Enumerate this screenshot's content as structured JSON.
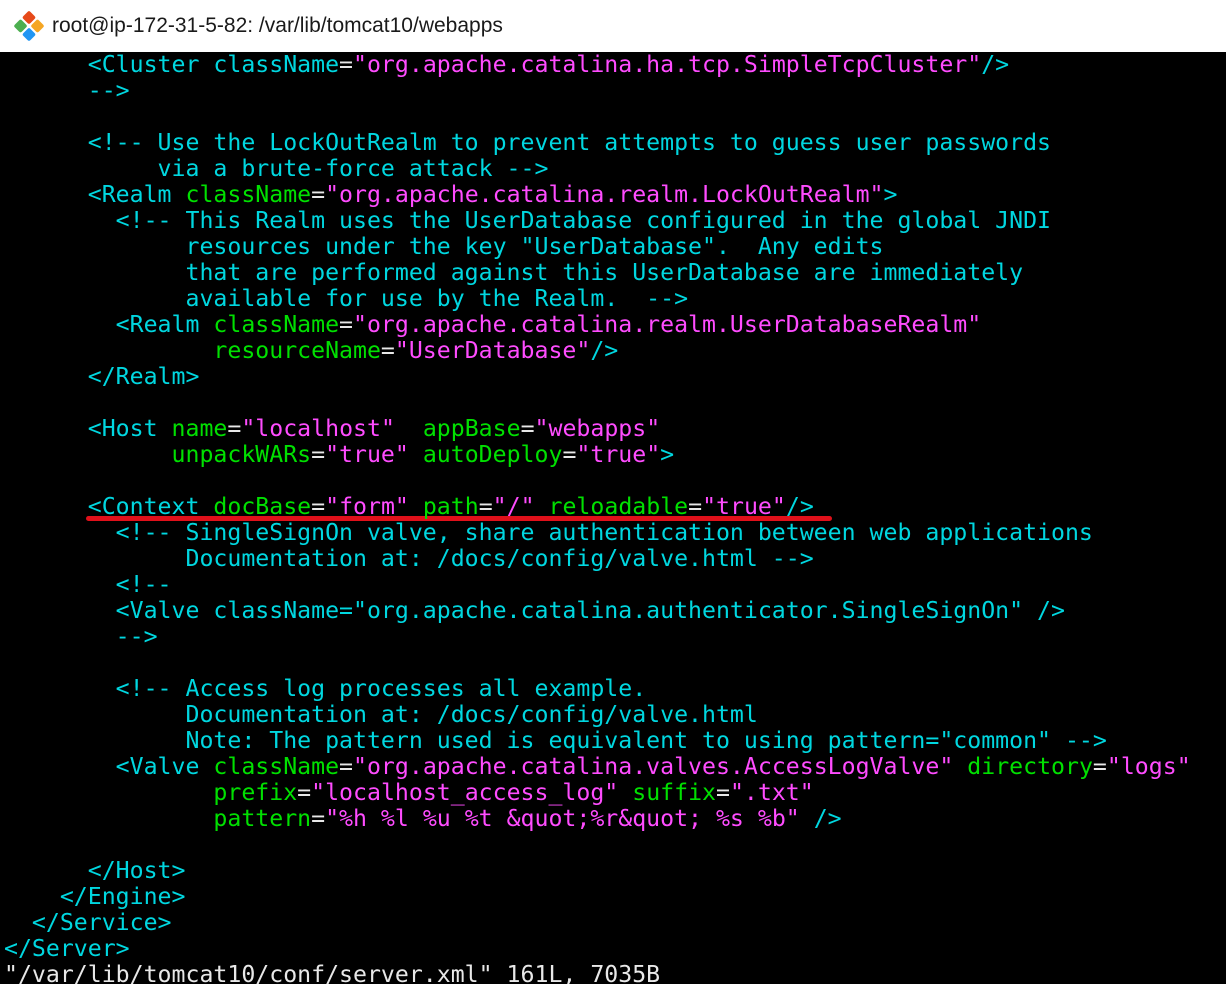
{
  "window": {
    "title": "root@ip-172-31-5-82: /var/lib/tomcat10/webapps",
    "icon": "git-bash-diamond-icon"
  },
  "colors": {
    "background": "#000000",
    "tag": "#00d7e0",
    "attribute": "#00e000",
    "string": "#ff4cff",
    "comment": "#00d7e0",
    "highlight_underline": "#e0101a"
  },
  "lines": [
    [
      [
        "t",
        "      <Cluster "
      ],
      [
        "t",
        "className"
      ],
      [
        "p",
        "="
      ],
      [
        "s",
        "\"org.apache.catalina.ha.tcp.SimpleTcpCluster\""
      ],
      [
        "t",
        "/>"
      ]
    ],
    [
      [
        "c",
        "      -->"
      ]
    ],
    [],
    [
      [
        "c",
        "      <!-- Use the LockOutRealm to prevent attempts to guess user passwords"
      ]
    ],
    [
      [
        "c",
        "           via a brute-force attack -->"
      ]
    ],
    [
      [
        "t",
        "      <Realm "
      ],
      [
        "a",
        "className"
      ],
      [
        "p",
        "="
      ],
      [
        "s",
        "\"org.apache.catalina.realm.LockOutRealm\""
      ],
      [
        "t",
        ">"
      ]
    ],
    [
      [
        "c",
        "        <!-- This Realm uses the UserDatabase configured in the global JNDI"
      ]
    ],
    [
      [
        "c",
        "             resources under the key \"UserDatabase\".  Any edits"
      ]
    ],
    [
      [
        "c",
        "             that are performed against this UserDatabase are immediately"
      ]
    ],
    [
      [
        "c",
        "             available for use by the Realm.  -->"
      ]
    ],
    [
      [
        "t",
        "        <Realm "
      ],
      [
        "a",
        "className"
      ],
      [
        "p",
        "="
      ],
      [
        "s",
        "\"org.apache.catalina.realm.UserDatabaseRealm\""
      ]
    ],
    [
      [
        "a",
        "               resourceName"
      ],
      [
        "p",
        "="
      ],
      [
        "s",
        "\"UserDatabase\""
      ],
      [
        "t",
        "/>"
      ]
    ],
    [
      [
        "t",
        "      </Realm>"
      ]
    ],
    [],
    [
      [
        "t",
        "      <Host "
      ],
      [
        "a",
        "name"
      ],
      [
        "p",
        "="
      ],
      [
        "s",
        "\"localhost\""
      ],
      [
        "t",
        "  "
      ],
      [
        "a",
        "appBase"
      ],
      [
        "p",
        "="
      ],
      [
        "s",
        "\"webapps\""
      ]
    ],
    [
      [
        "a",
        "            unpackWARs"
      ],
      [
        "p",
        "="
      ],
      [
        "s",
        "\"true\""
      ],
      [
        "t",
        " "
      ],
      [
        "a",
        "autoDeploy"
      ],
      [
        "p",
        "="
      ],
      [
        "s",
        "\"true\""
      ],
      [
        "t",
        ">"
      ]
    ],
    [],
    [
      [
        "t",
        "      <Context "
      ],
      [
        "a",
        "docBase"
      ],
      [
        "p",
        "="
      ],
      [
        "s",
        "\"form\""
      ],
      [
        "t",
        " "
      ],
      [
        "a",
        "path"
      ],
      [
        "p",
        "="
      ],
      [
        "s",
        "\"/\""
      ],
      [
        "t",
        " "
      ],
      [
        "a",
        "reloadable"
      ],
      [
        "p",
        "="
      ],
      [
        "s",
        "\"true\""
      ],
      [
        "t",
        "/>"
      ]
    ],
    [
      [
        "c",
        "        <!-- SingleSignOn valve, share authentication between web applications"
      ]
    ],
    [
      [
        "c",
        "             Documentation at: /docs/config/valve.html -->"
      ]
    ],
    [
      [
        "c",
        "        <!--"
      ]
    ],
    [
      [
        "c",
        "        <Valve className=\"org.apache.catalina.authenticator.SingleSignOn\" />"
      ]
    ],
    [
      [
        "c",
        "        -->"
      ]
    ],
    [],
    [
      [
        "c",
        "        <!-- Access log processes all example."
      ]
    ],
    [
      [
        "c",
        "             Documentation at: /docs/config/valve.html"
      ]
    ],
    [
      [
        "c",
        "             Note: The pattern used is equivalent to using pattern=\"common\" -->"
      ]
    ],
    [
      [
        "t",
        "        <Valve "
      ],
      [
        "a",
        "className"
      ],
      [
        "p",
        "="
      ],
      [
        "s",
        "\"org.apache.catalina.valves.AccessLogValve\""
      ],
      [
        "t",
        " "
      ],
      [
        "a",
        "directory"
      ],
      [
        "p",
        "="
      ],
      [
        "s",
        "\"logs\""
      ]
    ],
    [
      [
        "a",
        "               prefix"
      ],
      [
        "p",
        "="
      ],
      [
        "s",
        "\"localhost_access_log\""
      ],
      [
        "t",
        " "
      ],
      [
        "a",
        "suffix"
      ],
      [
        "p",
        "="
      ],
      [
        "s",
        "\".txt\""
      ]
    ],
    [
      [
        "a",
        "               pattern"
      ],
      [
        "p",
        "="
      ],
      [
        "s",
        "\"%h %l %u %t &quot;%r&quot; %s %b\""
      ],
      [
        "t",
        " />"
      ]
    ],
    [],
    [
      [
        "t",
        "      </Host>"
      ]
    ],
    [
      [
        "t",
        "    </Engine>"
      ]
    ],
    [
      [
        "t",
        "  </Service>"
      ]
    ],
    [
      [
        "t",
        "</Server>"
      ]
    ],
    [
      [
        "p",
        "\"/var/lib/tomcat10/conf/server.xml\" 161L, 7035B"
      ]
    ]
  ]
}
